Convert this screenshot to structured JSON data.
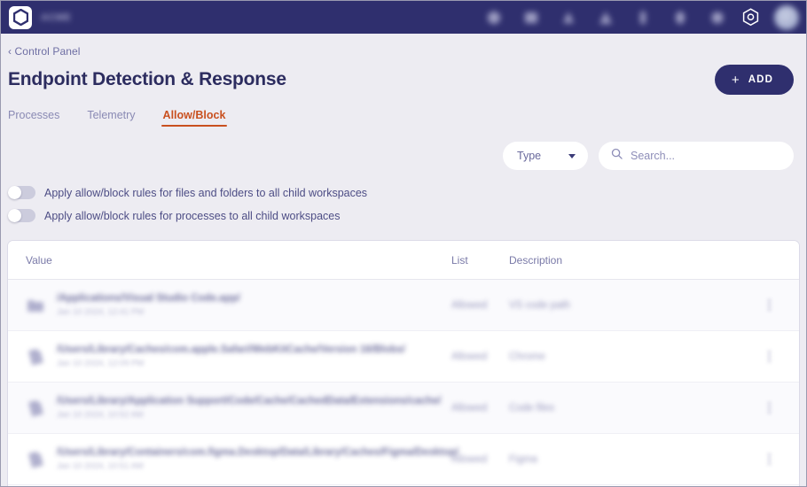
{
  "topbar": {
    "logo_icon": "hexagon-logo-icon",
    "brand_name": "ACME",
    "nav_icons": [
      {
        "name": "nav-icon-1"
      },
      {
        "name": "nav-icon-2"
      },
      {
        "name": "nav-icon-3"
      },
      {
        "name": "nav-icon-4"
      },
      {
        "name": "nav-icon-5"
      },
      {
        "name": "nav-icon-6"
      },
      {
        "name": "nav-icon-7"
      }
    ],
    "settings_icon": "hexagon-gear-icon",
    "avatar": "user-avatar",
    "background_color": "#2f2f6e"
  },
  "breadcrumb": {
    "label": "‹ Control Panel"
  },
  "header": {
    "title": "Endpoint Detection & Response",
    "add_button": {
      "label": "ADD",
      "plus": "+",
      "color": "#2f2f6e"
    }
  },
  "tabs": [
    {
      "label": "Processes",
      "active": false
    },
    {
      "label": "Telemetry",
      "active": false
    },
    {
      "label": "Allow/Block",
      "active": true
    }
  ],
  "tab_accent_color": "#c9501f",
  "filters": {
    "type_select": {
      "label": "Type",
      "caret_icon": "chevron-down-icon"
    },
    "search": {
      "placeholder": "Search...",
      "value": "",
      "icon": "search-icon"
    }
  },
  "toggles": [
    {
      "label": "Apply allow/block rules for files and folders to all child workspaces",
      "state": "off"
    },
    {
      "label": "Apply allow/block rules for processes to all child workspaces",
      "state": "off"
    }
  ],
  "table": {
    "columns": [
      "Value",
      "List",
      "Description"
    ],
    "rows": [
      {
        "icon": "folder-icon",
        "value": "/Applications/Visual Studio Code.app/",
        "subtext": "Jan 10 2024, 12:41 PM",
        "list": "Allowed",
        "description": "VS code path"
      },
      {
        "icon": "file-icon",
        "value": "/Users/Library/Caches/com.apple.Safari/WebKitCache/Version 16/Blobs/",
        "subtext": "Jan 10 2024, 12:09 PM",
        "list": "Allowed",
        "description": "Chrome"
      },
      {
        "icon": "file-icon",
        "value": "/Users/Library/Application Support/Code/Cache/CachedData/Extensions/cache/",
        "subtext": "Jan 10 2024, 10:52 AM",
        "list": "Allowed",
        "description": "Code files"
      },
      {
        "icon": "file-icon",
        "value": "/Users/Library/Containers/com.figma.Desktop/Data/Library/Caches/Figma/Desktop/",
        "subtext": "Jan 10 2024, 10:51 AM",
        "list": "Allowed",
        "description": "Figma"
      }
    ],
    "row_menu_icon": "kebab-menu-icon"
  }
}
